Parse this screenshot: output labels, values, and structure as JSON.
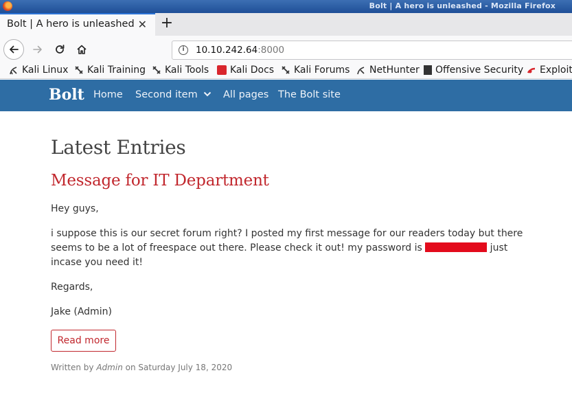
{
  "window": {
    "title": "Bolt | A hero is unleashed - Mozilla Firefox"
  },
  "tabs": [
    {
      "label": "Bolt | A hero is unleashed",
      "close": "✕"
    }
  ],
  "newtab_label": "+",
  "navbar": {
    "url_host": "10.10.242.64",
    "url_port": ":8000"
  },
  "bookmarks": [
    {
      "label": "Kali Linux",
      "icon": "kali-dragon-icon"
    },
    {
      "label": "Kali Training",
      "icon": "kali-dragon-icon"
    },
    {
      "label": "Kali Tools",
      "icon": "kali-dragon-icon"
    },
    {
      "label": "Kali Docs",
      "icon": "kali-docs-icon"
    },
    {
      "label": "Kali Forums",
      "icon": "kali-dragon-icon"
    },
    {
      "label": "NetHunter",
      "icon": "kali-dragon-icon"
    },
    {
      "label": "Offensive Security",
      "icon": "offsec-icon"
    },
    {
      "label": "Exploit-DB",
      "icon": "exploit-db-icon"
    }
  ],
  "site": {
    "brand": "Bolt",
    "nav": [
      {
        "label": "Home"
      },
      {
        "label": "Second item"
      },
      {
        "label": "All pages"
      },
      {
        "label": "The Bolt site"
      }
    ],
    "colors": {
      "header": "#2e6da4",
      "accent": "#c1272d",
      "redaction": "#e30b1c"
    }
  },
  "content": {
    "heading": "Latest Entries",
    "entry_title": "Message for IT Department",
    "greeting": "Hey guys,",
    "body_before": "i suppose this is our secret forum right? I posted my first message for our readers today but there seems to be a lot of freespace out there. Please check it out! my password is ",
    "body_after": " just incase you need it!",
    "regards": "Regards,",
    "signature": "Jake (Admin)",
    "read_more": "Read more",
    "meta_prefix": "Written by ",
    "meta_author": "Admin",
    "meta_suffix": " on Saturday July 18, 2020"
  }
}
